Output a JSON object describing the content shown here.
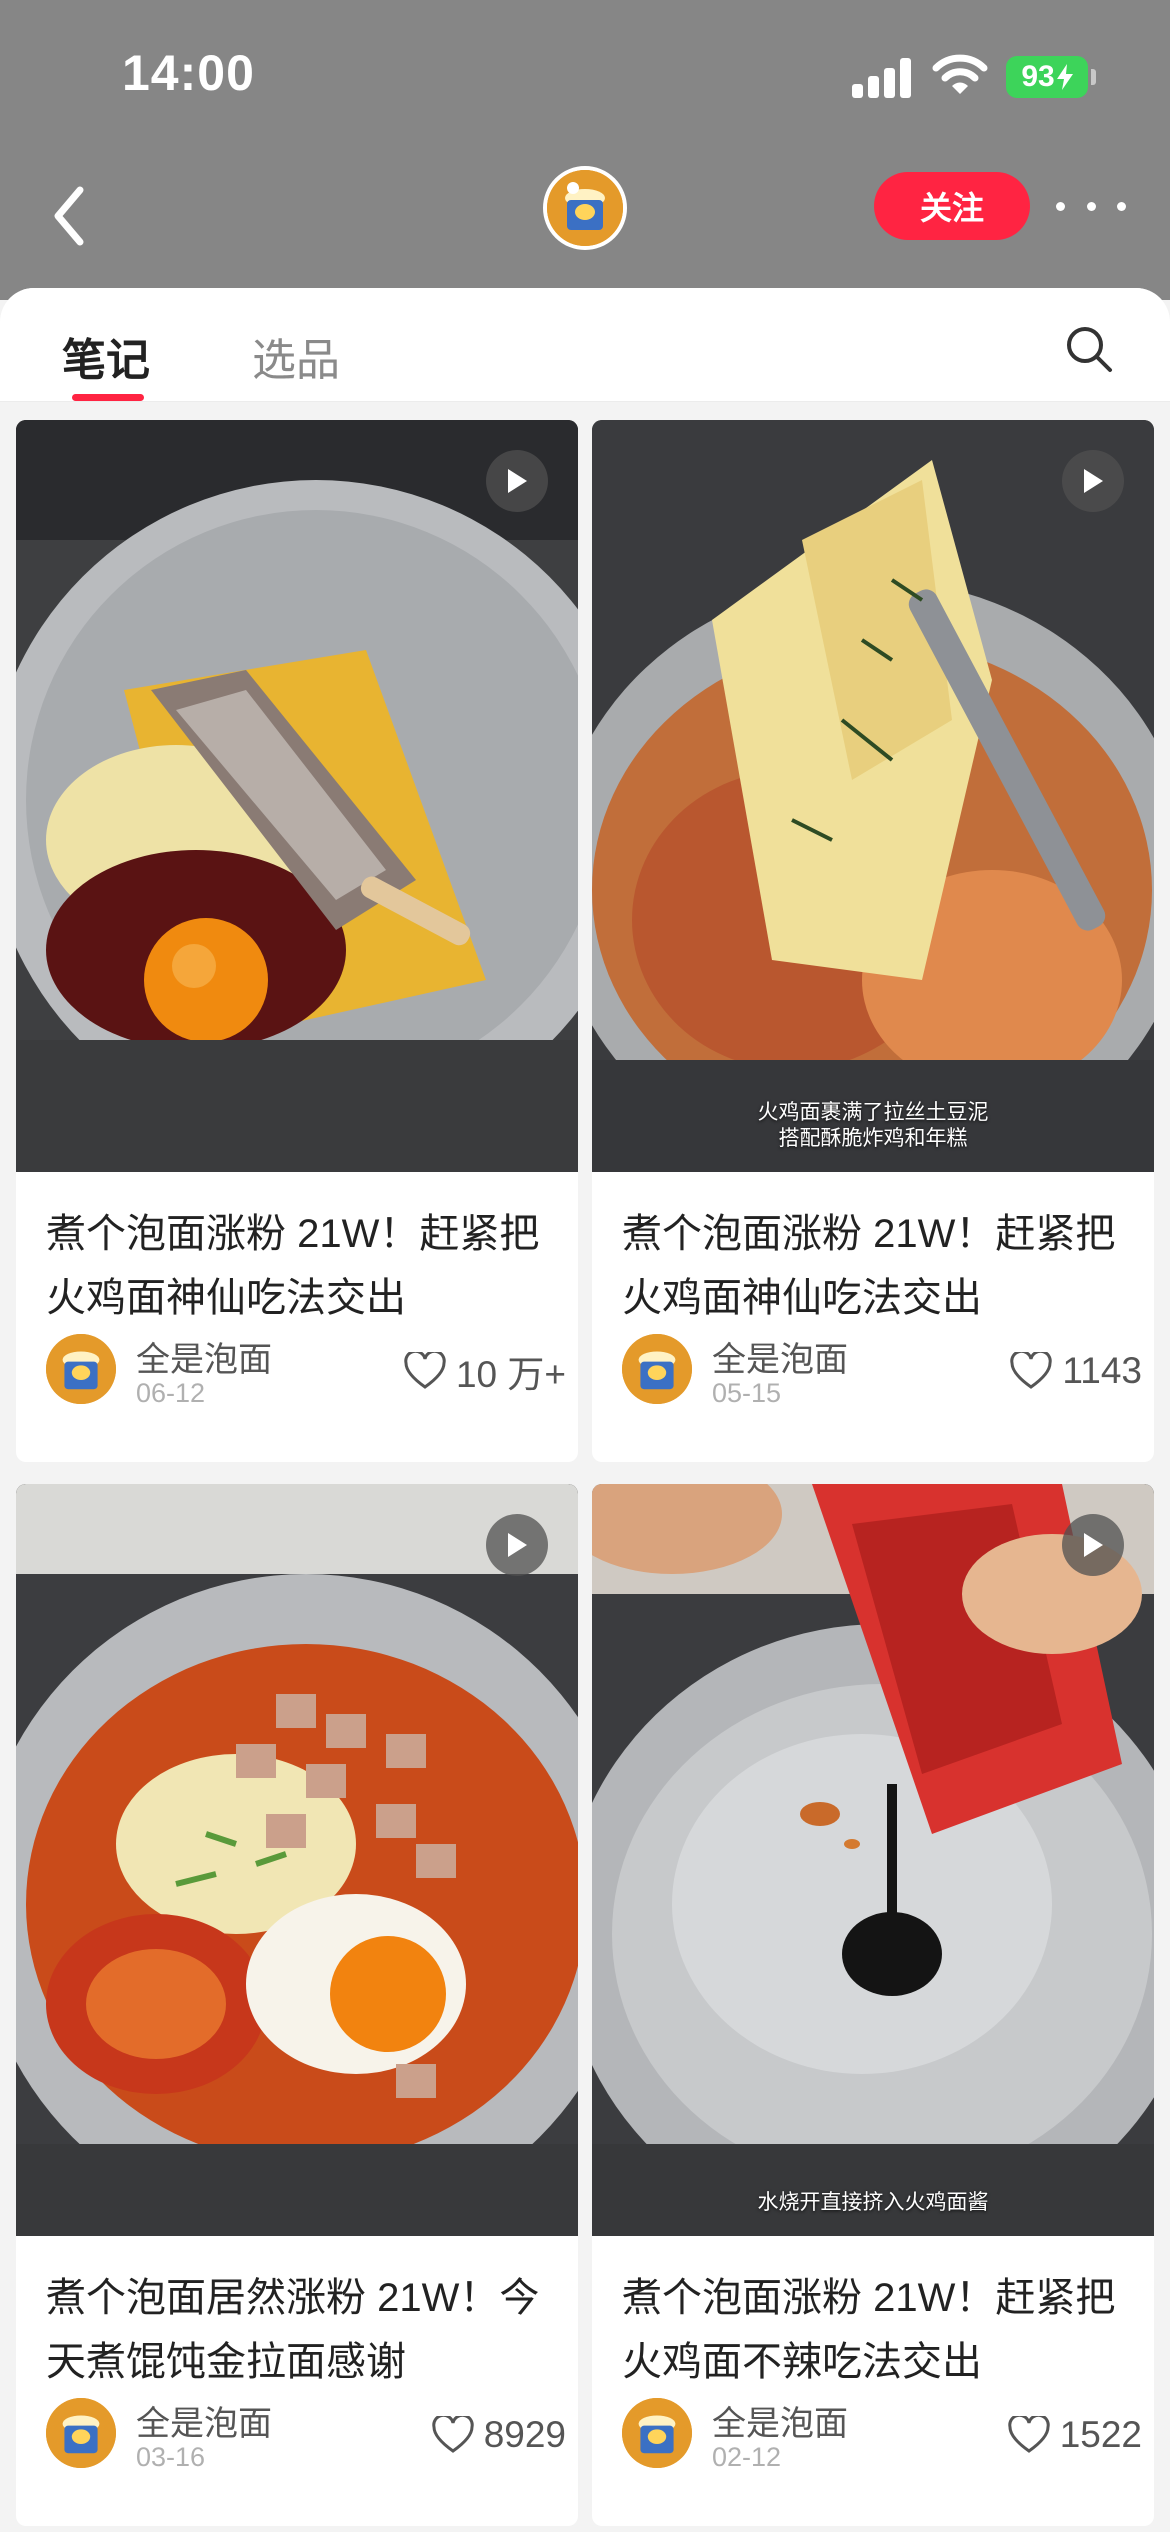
{
  "status_bar": {
    "time": "14:00",
    "battery": "93"
  },
  "header": {
    "follow_label": "关注"
  },
  "tabs": [
    {
      "label": "笔记"
    },
    {
      "label": "选品"
    }
  ],
  "posts": [
    {
      "title": "煮个泡面涨粉 21W！赶紧把火鸡面神仙吃法交出",
      "author": "全是泡面",
      "date": "06-12",
      "likes": "10 万+",
      "caption": ""
    },
    {
      "title": "煮个泡面涨粉 21W！赶紧把火鸡面神仙吃法交出",
      "author": "全是泡面",
      "date": "05-15",
      "likes": "1143",
      "caption": "火鸡面裹满了拉丝土豆泥\n搭配酥脆炸鸡和年糕"
    },
    {
      "title": "煮个泡面居然涨粉 21W！今天煮馄饨金拉面感谢",
      "author": "全是泡面",
      "date": "03-16",
      "likes": "8929",
      "caption": ""
    },
    {
      "title": "煮个泡面涨粉 21W！赶紧把火鸡面不辣吃法交出",
      "author": "全是泡面",
      "date": "02-12",
      "likes": "1522",
      "caption": "水烧开直接挤入火鸡面酱"
    }
  ],
  "colors": {
    "accent": "#ff2442",
    "header_bg": "#868686",
    "battery": "#3dd45a"
  },
  "icons": [
    "back-chevron-icon",
    "more-dots-icon",
    "search-icon",
    "play-icon",
    "heart-icon"
  ]
}
